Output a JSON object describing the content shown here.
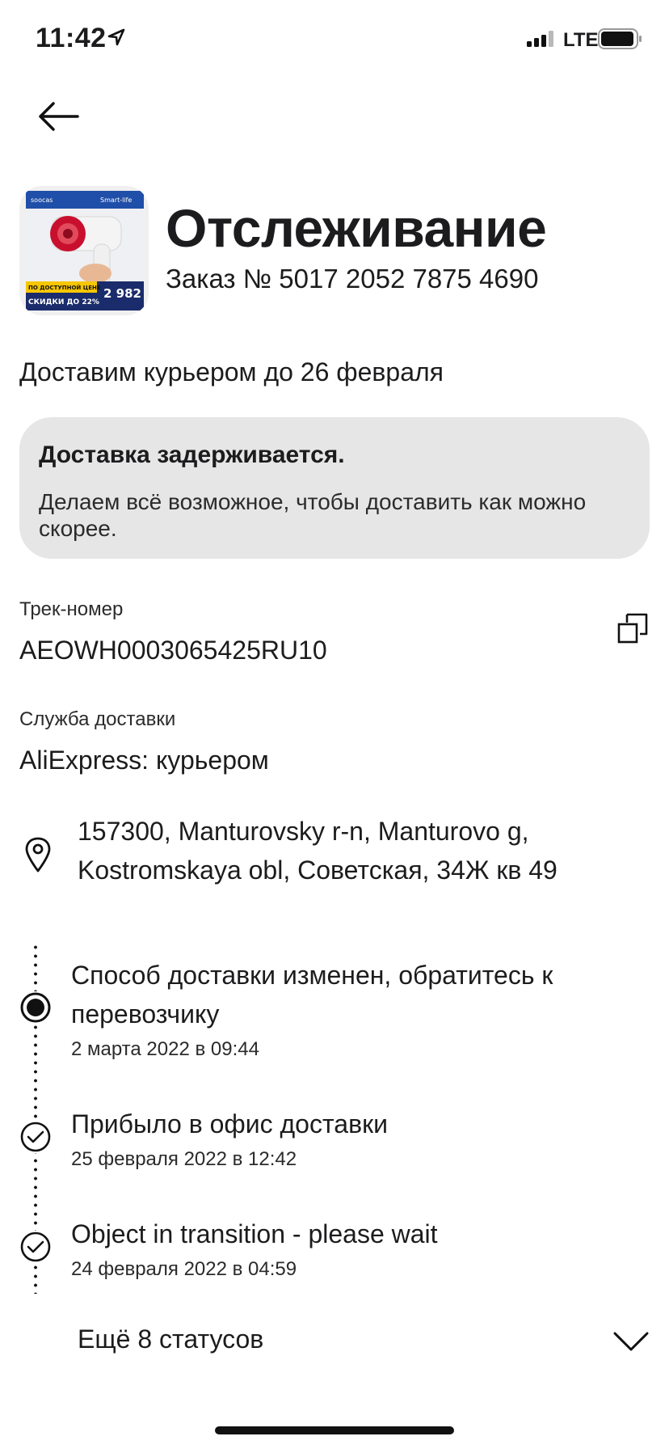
{
  "status_bar": {
    "time": "11:42",
    "network": "LTE"
  },
  "header": {
    "title": "Отслеживание",
    "order_number": "Заказ № 5017 2052 7875 4690"
  },
  "product_thumbnail": {
    "brand": "soocas",
    "badge_text": "Smart-life",
    "promo_line_1": "ПО ДОСТУПНОЙ ЦЕНЕ",
    "promo_line_2": "СКИДКИ ДО 22%",
    "price": "2 982"
  },
  "delivery_estimate": "Доставим курьером до 26 февраля",
  "delay_notice": {
    "title": "Доставка задерживается.",
    "text": "Делаем всё возможное, чтобы доставить как можно скорее."
  },
  "tracking": {
    "label": "Трек-номер",
    "value": "AEOWH0003065425RU10"
  },
  "service": {
    "label": "Служба доставки",
    "value": "AliExpress: курьером"
  },
  "address": "157300, Manturovsky r-n, Manturovo g, Kostromskaya obl, Советская, 34Ж кв 49",
  "timeline": [
    {
      "status": "Способ доставки изменен, обратитесь к перевозчику",
      "date": "2 марта 2022 в 09:44",
      "icon": "current-dot-icon"
    },
    {
      "status": "Прибыло в офис доставки",
      "date": "25 февраля 2022 в 12:42",
      "icon": "check-circle-icon"
    },
    {
      "status": "Object in transition - please wait",
      "date": "24 февраля 2022 в 04:59",
      "icon": "check-circle-icon"
    }
  ],
  "more_statuses": "Ещё 8 статусов",
  "colors": {
    "card_background": "#e6e6e6",
    "text": "#1c1c1e",
    "thumbnail_accent": "#c8102e"
  }
}
